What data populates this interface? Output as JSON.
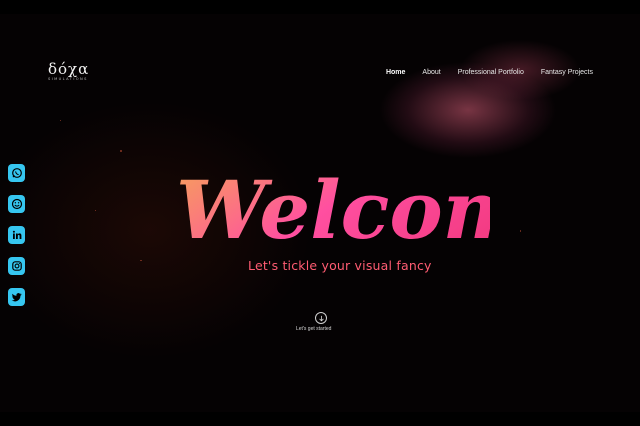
{
  "brand": {
    "name": "δόχα",
    "tagline": "SIMULATIONS"
  },
  "nav": {
    "items": [
      {
        "label": "Home",
        "active": true
      },
      {
        "label": "About",
        "active": false
      },
      {
        "label": "Professional Portfolio",
        "active": false
      },
      {
        "label": "Fantasy Projects",
        "active": false
      }
    ]
  },
  "social": [
    "whatsapp-icon",
    "smiley-icon",
    "linkedin-icon",
    "instagram-icon",
    "twitter-icon"
  ],
  "hero": {
    "title": "Welcome!",
    "subtitle": "Let's tickle your visual fancy",
    "cta_label": "Let's get started"
  },
  "colors": {
    "accent_social": "#36c6f0",
    "title_gradient": [
      "#f6a25a",
      "#ff4fa0",
      "#f0357a"
    ],
    "subtitle": "#ff5c72"
  }
}
